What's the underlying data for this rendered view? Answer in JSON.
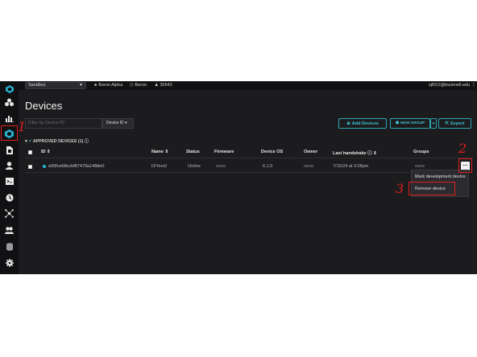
{
  "topbar": {
    "sandbox": "Sandbox",
    "device_types": [
      "Boron Alpha",
      "Boron"
    ],
    "org_id": "30542",
    "user_email": "sjf012@bucknell.edu"
  },
  "page": {
    "title": "Devices",
    "filter_placeholder": "Filter by Device ID",
    "filter_select": "Device ID",
    "add_devices": "Add Devices",
    "new_group": "NEW GROUP",
    "export": "Export",
    "section": "APPROVED DEVICES (1)"
  },
  "table": {
    "headers": [
      "ID",
      "Name",
      "Status",
      "Firmware",
      "Device OS",
      "Owner",
      "Last handshake",
      "Groups"
    ],
    "rows": [
      {
        "id": "e00fce68ccbf87479a148de0",
        "name": "DIYers2",
        "status": "Online",
        "firmware": "none",
        "device_os": "6.1.0",
        "owner": "none",
        "last_handshake": "7/15/24 at 3:08pm",
        "groups": "none"
      }
    ]
  },
  "menu": {
    "more_glyph": "...",
    "items": [
      "Mark development device",
      "Remove device"
    ]
  },
  "annotations": [
    "1",
    "2",
    "3"
  ],
  "colors": {
    "accent": "#3fc2cf",
    "annotation": "#e11d1d",
    "background": "#1c1c1f"
  }
}
